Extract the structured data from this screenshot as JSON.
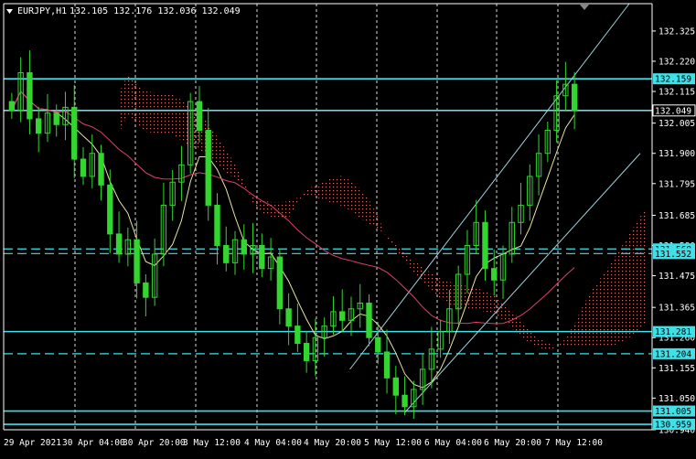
{
  "header": {
    "symbol": "EURJPY,H1",
    "quotes": "132.105 132.176 132.036 132.049"
  },
  "colors": {
    "background": "#000000",
    "bull": "#33d62e",
    "bear": "#33d62e",
    "grid": "#ffffff",
    "axis": "#ffffff",
    "hline": "#40e0e8",
    "channel": "#9fd3dc",
    "ma_yellow": "#e8e4a0",
    "ma_pink": "#e0406a",
    "cloud": "#f08080",
    "label_bg": "#40e0e8",
    "label_text": "#000000",
    "price_line_label_bg": "#000000"
  },
  "chart_data": {
    "type": "candlestick",
    "ylim": [
      130.94,
      132.42
    ],
    "x_ticks": [
      "29 Apr 2021",
      "30 Apr 04:00",
      "30 Apr 20:00",
      "3 May 12:00",
      "4 May 04:00",
      "4 May 20:00",
      "5 May 12:00",
      "6 May 04:00",
      "6 May 20:00",
      "7 May 12:00"
    ],
    "y_ticks": [
      "132.325",
      "132.220",
      "132.115",
      "132.005",
      "131.900",
      "131.795",
      "131.685",
      "131.580",
      "131.475",
      "131.365",
      "131.260",
      "131.155",
      "131.050",
      "130.940"
    ],
    "closes": [
      132.05,
      132.18,
      132.02,
      131.97,
      132.04,
      132.0,
      132.06,
      131.88,
      131.82,
      131.9,
      131.79,
      131.62,
      131.55,
      131.6,
      131.45,
      131.4,
      131.55,
      131.72,
      131.8,
      131.86,
      132.08,
      131.98,
      131.72,
      131.58,
      131.52,
      131.6,
      131.55,
      131.58,
      131.5,
      131.54,
      131.36,
      131.3,
      131.24,
      131.18,
      131.26,
      131.3,
      131.35,
      131.32,
      131.36,
      131.38,
      131.26,
      131.21,
      131.12,
      131.06,
      131.02,
      131.08,
      131.15,
      131.22,
      131.28,
      131.36,
      131.48,
      131.58,
      131.66,
      131.5,
      131.46,
      131.55,
      131.66,
      131.72,
      131.82,
      131.9,
      131.98,
      132.1,
      132.14,
      132.05
    ],
    "horizontal_levels": [
      {
        "price": 132.159,
        "label": "132.159",
        "style": "solid",
        "tag": true
      },
      {
        "price": 132.049,
        "label": "132.049",
        "style": "solid",
        "tag": false
      },
      {
        "price": 131.568,
        "label": "131.568",
        "style": "dashed",
        "tag": true
      },
      {
        "price": 131.552,
        "label": "131.552",
        "style": "dashed",
        "tag": false
      },
      {
        "price": 131.281,
        "label": "131.281",
        "style": "solid",
        "tag": true
      },
      {
        "price": 131.204,
        "label": "131.204",
        "style": "dashed",
        "tag": true
      },
      {
        "price": 131.005,
        "label": "131.005",
        "style": "solid",
        "tag": true
      },
      {
        "price": 130.959,
        "label": "130.959",
        "style": "solid",
        "tag": true
      }
    ],
    "grid": true
  }
}
